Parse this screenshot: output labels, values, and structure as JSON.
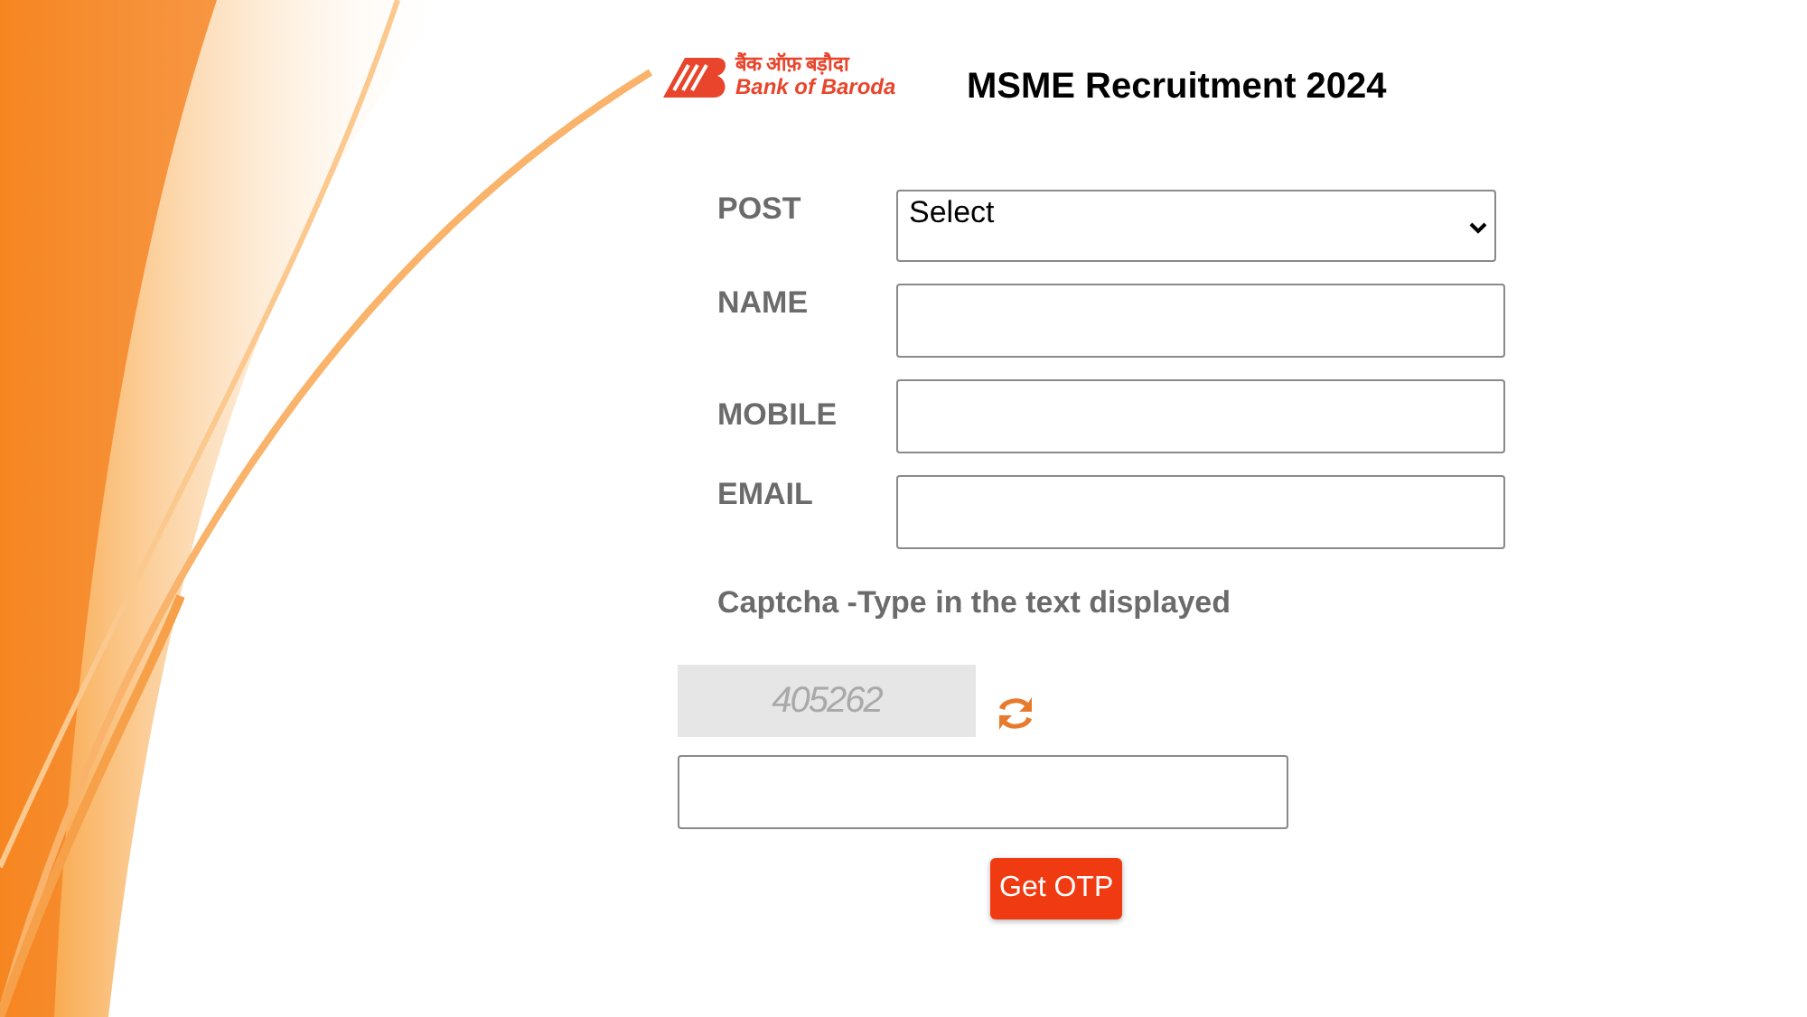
{
  "header": {
    "logo_hindi": "बैंक ऑफ़ बड़ौदा",
    "logo_english": "Bank of Baroda",
    "title": "MSME Recruitment 2024"
  },
  "fields": [
    {
      "label": "POST",
      "kind": "select",
      "value": "Select"
    },
    {
      "label": "NAME",
      "kind": "text"
    },
    {
      "label": "MOBILE",
      "kind": "text"
    },
    {
      "label": "EMAIL",
      "kind": "text"
    }
  ],
  "captcha": {
    "heading": "Captcha -Type in the text displayed",
    "code": "405262"
  },
  "submit": "Get OTP"
}
